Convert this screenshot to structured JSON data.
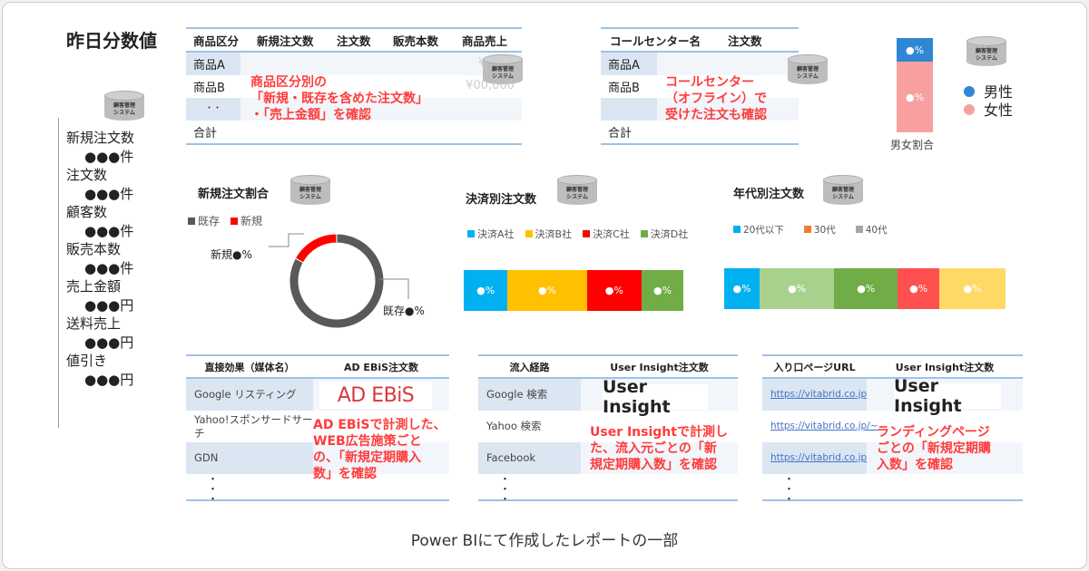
{
  "db_icon": {
    "line1": "顧客管理",
    "line2": "システム"
  },
  "yesterday": {
    "title": "昨日分数値",
    "items": [
      {
        "label": "新規注文数",
        "value": "●●●件"
      },
      {
        "label": "注文数",
        "value": "●●●件"
      },
      {
        "label": "顧客数",
        "value": "●●●件"
      },
      {
        "label": "販売本数",
        "value": "●●●件"
      },
      {
        "label": "売上金額",
        "value": "●●●円"
      },
      {
        "label": "送料売上",
        "value": "●●●円"
      },
      {
        "label": "値引き",
        "value": "●●●円"
      }
    ]
  },
  "product_table": {
    "headers": [
      "商品区分",
      "新規注文数",
      "注文数",
      "販売本数",
      "商品売上"
    ],
    "rows": [
      "商品A",
      "商品B",
      "・・",
      "合計"
    ],
    "values": [
      "¥",
      "¥00,000"
    ],
    "note": [
      "商品区分別の",
      "「新規・既存を含めた注文数」",
      "・「売上金額」を確認"
    ]
  },
  "callcenter_table": {
    "headers": [
      "コールセンター名",
      "注文数"
    ],
    "rows": [
      "商品A",
      "商品B",
      "",
      "合計"
    ],
    "note": [
      "コールセンター",
      "（オフライン）で",
      "受けた注文も確認"
    ]
  },
  "gender": {
    "label": "男女割合",
    "segments": [
      {
        "name": "男性",
        "label": "●%",
        "share": 0.25,
        "color": "#2e86d4"
      },
      {
        "name": "女性",
        "label": "●%",
        "share": 0.75,
        "color": "#f8a0a0"
      }
    ]
  },
  "new_ratio": {
    "title": "新規注文割合",
    "legend": [
      {
        "name": "既存",
        "color": "#595959"
      },
      {
        "name": "新規",
        "color": "#ff0000"
      }
    ],
    "labels": {
      "new": "新規●%",
      "existing": "既存●%"
    },
    "shares": {
      "new": 0.17,
      "existing": 0.83
    }
  },
  "payment": {
    "title": "決済別注文数",
    "segments": [
      {
        "name": "決済A社",
        "label": "●%",
        "share": 0.2,
        "color": "#00b0f0"
      },
      {
        "name": "決済B社",
        "label": "●%",
        "share": 0.36,
        "color": "#ffc000"
      },
      {
        "name": "決済C社",
        "label": "●%",
        "share": 0.25,
        "color": "#ff0000"
      },
      {
        "name": "決済D社",
        "label": "●%",
        "share": 0.19,
        "color": "#70ad47"
      }
    ]
  },
  "age": {
    "title": "年代別注文数",
    "legend": [
      {
        "name": "20代以下",
        "color": "#00b0f0"
      },
      {
        "name": "30代",
        "color": "#ed7d31"
      },
      {
        "name": "40代",
        "color": "#a5a5a5"
      }
    ],
    "segments": [
      {
        "label": "●%",
        "share": 0.126,
        "color": "#00b0f0"
      },
      {
        "label": "●%",
        "share": 0.265,
        "color": "#a9d18e"
      },
      {
        "label": "●%",
        "share": 0.226,
        "color": "#70ad47"
      },
      {
        "label": "●%",
        "share": 0.148,
        "color": "#ff5050"
      },
      {
        "label": "●%",
        "share": 0.235,
        "color": "#ffd966"
      }
    ]
  },
  "adebis_table": {
    "headers": [
      "直接効果（媒体名）",
      "AD EBiS注文数"
    ],
    "rows": [
      "Google リスティング",
      "Yahoo!スポンサードサーチ",
      "GDN"
    ],
    "logo": "AD EBiS",
    "note": [
      "AD EBiSで計測した、",
      "WEB広告施策ごと",
      "の、「新規定期購入",
      "数」を確認"
    ]
  },
  "inflow_table": {
    "headers": [
      "流入経路",
      "User Insight注文数"
    ],
    "rows": [
      "Google 検索",
      "Yahoo 検索",
      "Facebook"
    ],
    "logo": "User Insight",
    "note": [
      "User Insightで計測し",
      "た、流入元ごとの「新",
      "規定期購入数」を確認"
    ]
  },
  "landing_table": {
    "headers": [
      "入り口ページURL",
      "User Insight注文数"
    ],
    "rows": [
      "https://vitabrid.co.jp/~",
      "https://vitabrid.co.jp/~",
      "https://vitabrid.co.jp/~"
    ],
    "logo": "User Insight",
    "note": [
      "ランディングページ",
      "ごとの「新規定期購",
      "入数」を確認"
    ]
  },
  "caption": "Power BIにて作成したレポートの一部"
}
